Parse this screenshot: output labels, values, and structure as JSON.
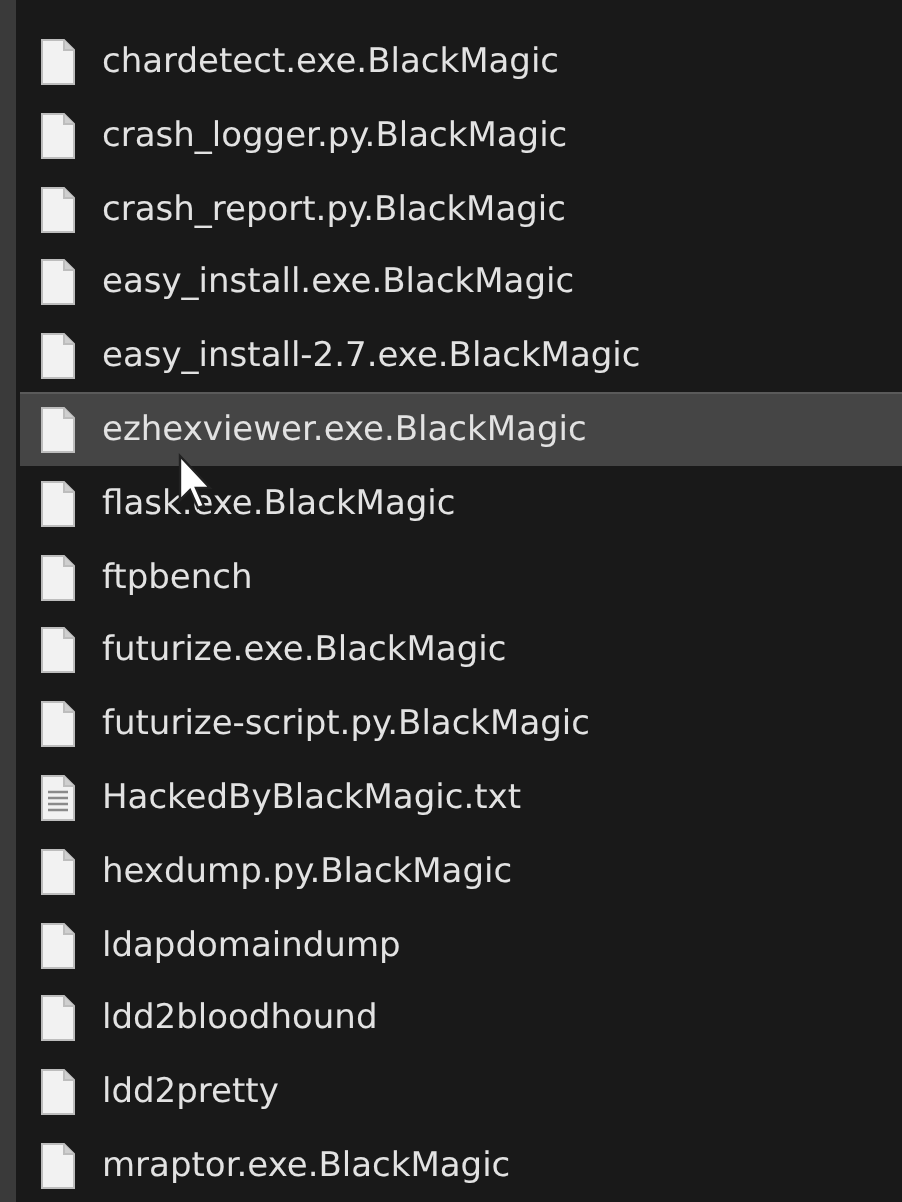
{
  "files": [
    {
      "name": "chardetect.exe.BlackMagic",
      "kind": "file",
      "highlighted": false
    },
    {
      "name": "crash_logger.py.BlackMagic",
      "kind": "file",
      "highlighted": false
    },
    {
      "name": "crash_report.py.BlackMagic",
      "kind": "file",
      "highlighted": false
    },
    {
      "name": "easy_install.exe.BlackMagic",
      "kind": "file",
      "highlighted": false
    },
    {
      "name": "easy_install-2.7.exe.BlackMagic",
      "kind": "file",
      "highlighted": false
    },
    {
      "name": "ezhexviewer.exe.BlackMagic",
      "kind": "file",
      "highlighted": true
    },
    {
      "name": "flask.exe.BlackMagic",
      "kind": "file",
      "highlighted": false
    },
    {
      "name": "ftpbench",
      "kind": "file",
      "highlighted": false
    },
    {
      "name": "futurize.exe.BlackMagic",
      "kind": "file",
      "highlighted": false
    },
    {
      "name": "futurize-script.py.BlackMagic",
      "kind": "file",
      "highlighted": false
    },
    {
      "name": "HackedByBlackMagic.txt",
      "kind": "text",
      "highlighted": false
    },
    {
      "name": "hexdump.py.BlackMagic",
      "kind": "file",
      "highlighted": false
    },
    {
      "name": "ldapdomaindump",
      "kind": "file",
      "highlighted": false
    },
    {
      "name": "ldd2bloodhound",
      "kind": "file",
      "highlighted": false
    },
    {
      "name": "ldd2pretty",
      "kind": "file",
      "highlighted": false
    },
    {
      "name": "mraptor.exe.BlackMagic",
      "kind": "file",
      "highlighted": false
    }
  ]
}
